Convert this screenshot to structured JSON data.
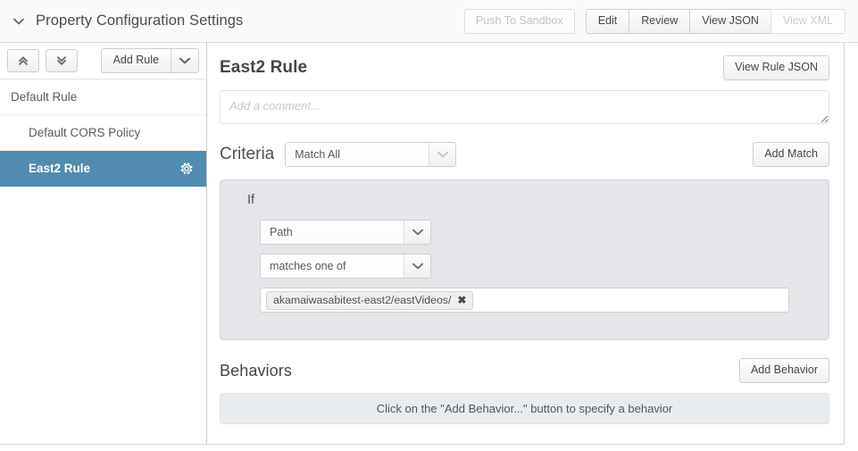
{
  "header": {
    "title": "Property Configuration Settings",
    "collapse_icon": "chevron-down-icon",
    "actions": {
      "push_to_sandbox": "Push To Sandbox",
      "edit": "Edit",
      "review": "Review",
      "view_json": "View JSON",
      "view_xml": "View XML"
    }
  },
  "sidebar": {
    "toolbar": {
      "collapse_all_icon": "double-chevron-up-icon",
      "expand_all_icon": "double-chevron-down-icon",
      "add_rule_label": "Add Rule",
      "add_rule_caret_icon": "chevron-down-icon"
    },
    "items": [
      {
        "label": "Default Rule",
        "indent": false,
        "selected": false,
        "gear": false
      },
      {
        "label": "Default CORS Policy",
        "indent": true,
        "selected": false,
        "gear": false
      },
      {
        "label": "East2 Rule",
        "indent": true,
        "selected": true,
        "gear": true
      }
    ]
  },
  "main": {
    "rule_title": "East2 Rule",
    "view_rule_json_label": "View Rule JSON",
    "comment": {
      "placeholder": "Add a comment...",
      "value": ""
    },
    "criteria": {
      "label": "Criteria",
      "match_mode": "Match All",
      "add_match_label": "Add Match",
      "if_label": "If",
      "condition_field": "Path",
      "condition_operator": "matches one of",
      "values": [
        {
          "text": "akamaiwasabitest-east2/eastVideos/",
          "remove_icon": "close-icon"
        }
      ]
    },
    "behaviors": {
      "label": "Behaviors",
      "add_behavior_label": "Add Behavior",
      "empty_message": "Click on the \"Add Behavior...\" button to specify a behavior"
    }
  },
  "colors": {
    "accent": "#4f8cb0",
    "panel_bg": "#e4e6e9",
    "empty_bg": "#e8ecee",
    "topbar_bg": "#fafafa",
    "text": "#4c4c4e"
  }
}
